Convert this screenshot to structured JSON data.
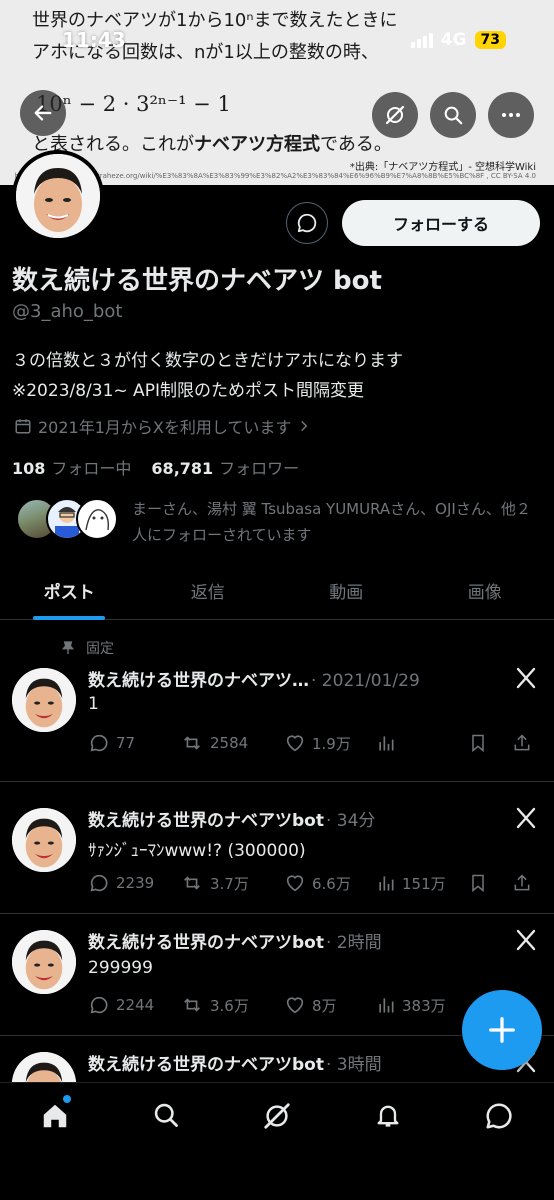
{
  "status_bar": {
    "time": "11:43",
    "network": "4G",
    "battery": "73"
  },
  "banner": {
    "line1": "世界のナベアツが1から10ⁿまで数えたときに",
    "line2": "アホになる回数は、nが1以上の整数の時、",
    "equation_text": "10ⁿ − 2 · 3²ⁿ⁻¹ − 1",
    "line4_prefix": "と表される。これが",
    "line4_bold": "ナベアツ方程式",
    "line4_suffix": "である。",
    "source": "*出典:「ナベアツ方程式」- 空想科学Wiki",
    "url": "https://dreamscience.miraheze.org/wiki/%E3%83%8A%E3%83%99%E3%82%A2%E3%83%84%E6%96%B9%E7%A8%8B%E5%BC%8F , CC BY-SA 4.0"
  },
  "profile": {
    "follow_label": "フォローする",
    "display_name": "数え続ける世界のナベアツ bot",
    "handle": "@3_aho_bot",
    "bio_line1": "３の倍数と３が付く数字のときだけアホになります",
    "bio_line2": "※2023/8/31~ API制限のためポスト間隔変更",
    "joined": "2021年1月からXを利用しています",
    "following_count": "108",
    "following_label": "フォロー中",
    "followers_count": "68,781",
    "followers_label": "フォロワー",
    "followed_by_text": "まーさん、湯村 翼 Tsubasa YUMURAさん、OJIさん、他２人にフォローされています"
  },
  "tabs": [
    {
      "label": "ポスト"
    },
    {
      "label": "返信"
    },
    {
      "label": "動画"
    },
    {
      "label": "画像"
    }
  ],
  "pinned_label": "固定",
  "posts": [
    {
      "name": "数え続ける世界のナベアツ…",
      "meta": "· 2021/01/29",
      "text": "1",
      "replies": "77",
      "reposts": "2584",
      "likes": "1.9万",
      "views": ""
    },
    {
      "name": "数え続ける世界のナベアツbot",
      "meta": "· 34分",
      "text": "ｻｧﾝｼﾞｭｰﾏﾝwww!?  (300000)",
      "replies": "2239",
      "reposts": "3.7万",
      "likes": "6.6万",
      "views": "151万"
    },
    {
      "name": "数え続ける世界のナベアツbot",
      "meta": "· 2時間",
      "text": "299999",
      "replies": "2244",
      "reposts": "3.6万",
      "likes": "8万",
      "views": "383万"
    },
    {
      "name": "数え続ける世界のナベアツbot",
      "meta": "· 3時間",
      "text": "",
      "replies": "",
      "reposts": "",
      "likes": "",
      "views": ""
    }
  ],
  "colors": {
    "accent": "#1d9bf0",
    "muted": "#71767b",
    "text": "#e7e9ea",
    "battery": "#ffd400"
  }
}
